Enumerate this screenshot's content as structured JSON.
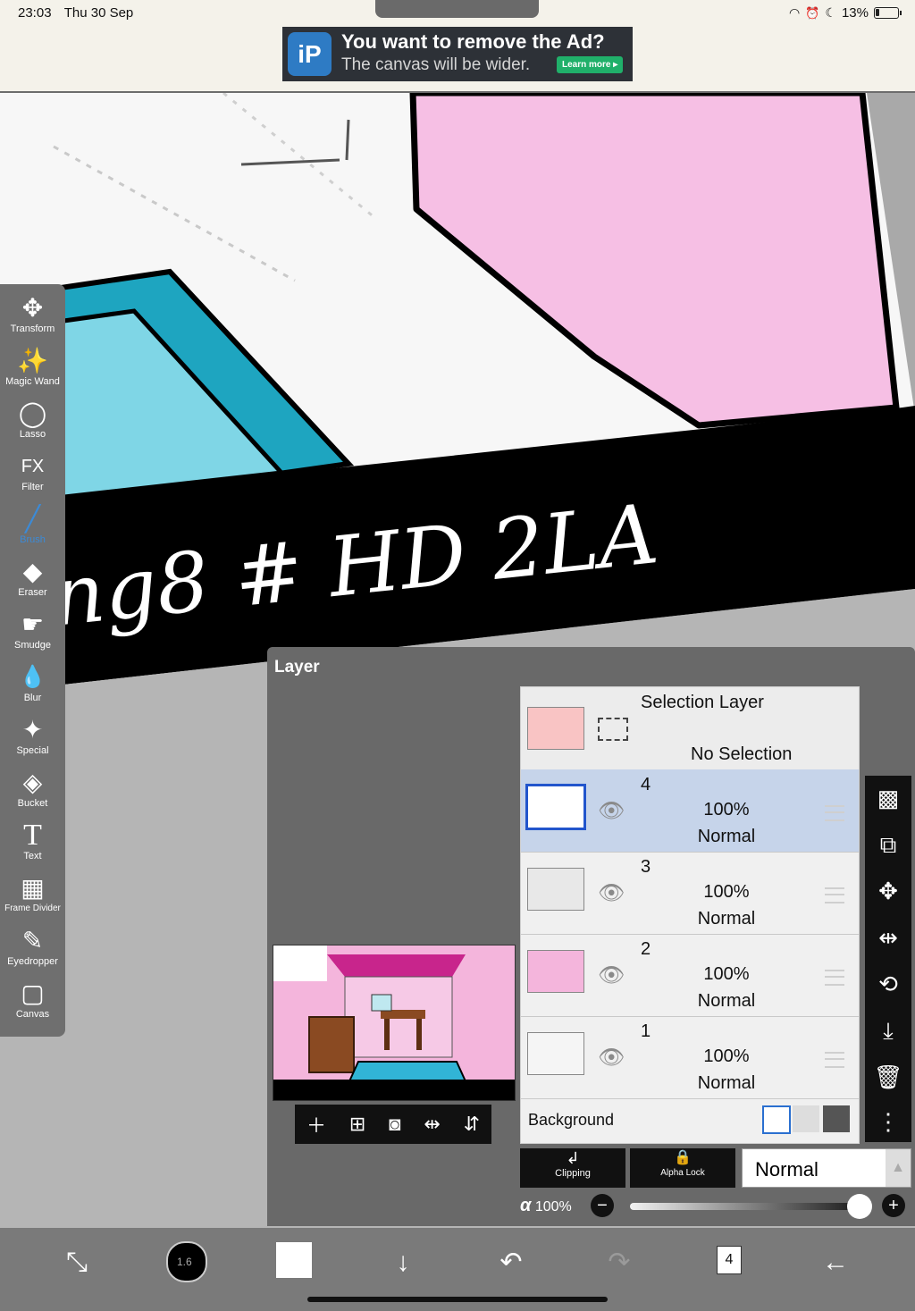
{
  "status": {
    "time": "23:03",
    "date": "Thu 30 Sep",
    "battery": "13%"
  },
  "ad": {
    "title": "You want to remove the Ad?",
    "subtitle": "The canvas will be wider.",
    "button": "Learn more ▸",
    "logo": "iP"
  },
  "canvas": {
    "text": "ng8  # HD 2LA"
  },
  "tools": [
    {
      "label": "Transform",
      "icon": "✥"
    },
    {
      "label": "Magic Wand",
      "icon": "✨"
    },
    {
      "label": "Lasso",
      "icon": "◯"
    },
    {
      "label": "Filter",
      "icon": "FX"
    },
    {
      "label": "Brush",
      "icon": "╱"
    },
    {
      "label": "Eraser",
      "icon": "◆"
    },
    {
      "label": "Smudge",
      "icon": "☛"
    },
    {
      "label": "Blur",
      "icon": "💧"
    },
    {
      "label": "Special",
      "icon": "✦"
    },
    {
      "label": "Bucket",
      "icon": "◈"
    },
    {
      "label": "Text",
      "icon": "T"
    },
    {
      "label": "Frame Divider",
      "icon": "▦"
    },
    {
      "label": "Eyedropper",
      "icon": "✎"
    },
    {
      "label": "Canvas",
      "icon": "▢"
    }
  ],
  "layer_panel": {
    "title": "Layer",
    "selection_layer": {
      "name": "Selection Layer",
      "status": "No Selection"
    },
    "layers": [
      {
        "num": "4",
        "opacity": "100%",
        "blend": "Normal"
      },
      {
        "num": "3",
        "opacity": "100%",
        "blend": "Normal"
      },
      {
        "num": "2",
        "opacity": "100%",
        "blend": "Normal"
      },
      {
        "num": "1",
        "opacity": "100%",
        "blend": "Normal"
      }
    ],
    "background_label": "Background",
    "clipping_label": "Clipping",
    "alpha_lock_label": "Alpha Lock",
    "blend_mode": "Normal",
    "alpha_symbol": "α",
    "opacity": "100%",
    "opacity_fraction": 0.95
  },
  "bottom": {
    "brush_size": "1.6",
    "layer_count": "4"
  }
}
